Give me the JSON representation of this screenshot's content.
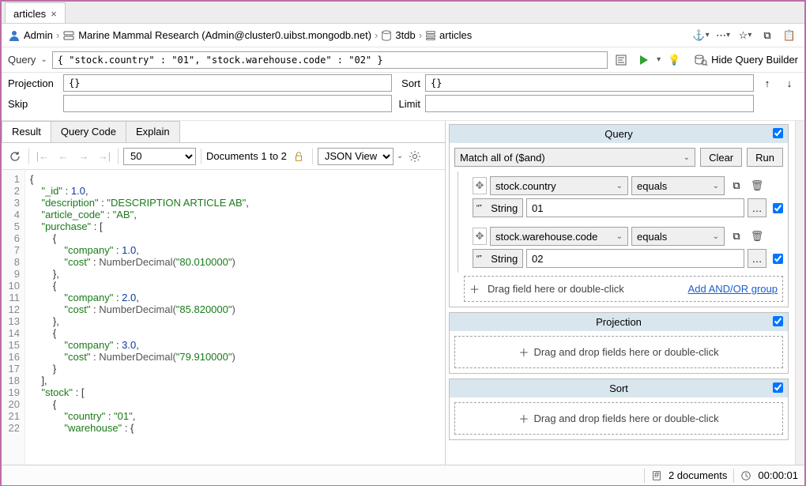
{
  "tab": {
    "title": "articles"
  },
  "breadcrumb": {
    "user": "Admin",
    "connection": "Marine Mammal Research (Admin@cluster0.uibst.mongodb.net)",
    "database": "3tdb",
    "collection": "articles"
  },
  "query": {
    "label": "Query",
    "text": "{ \"stock.country\" : \"01\", \"stock.warehouse.code\" : \"02\" }",
    "hide_builder_label": "Hide Query Builder"
  },
  "form": {
    "projection_label": "Projection",
    "projection_value": "{}",
    "sort_label": "Sort",
    "sort_value": "{}",
    "skip_label": "Skip",
    "skip_value": "",
    "limit_label": "Limit",
    "limit_value": ""
  },
  "left_tabs": {
    "result": "Result",
    "query_code": "Query Code",
    "explain": "Explain"
  },
  "left_toolbar": {
    "page_size": "50",
    "doc_range": "Documents 1 to 2",
    "view_mode": "JSON View"
  },
  "json_lines": [
    "{",
    "    \"_id\" : 1.0,",
    "    \"description\" : \"DESCRIPTION ARTICLE AB\",",
    "    \"article_code\" : \"AB\",",
    "    \"purchase\" : [",
    "        {",
    "            \"company\" : 1.0,",
    "            \"cost\" : NumberDecimal(\"80.010000\")",
    "        },",
    "        {",
    "            \"company\" : 2.0,",
    "            \"cost\" : NumberDecimal(\"85.820000\")",
    "        },",
    "        {",
    "            \"company\" : 3.0,",
    "            \"cost\" : NumberDecimal(\"79.910000\")",
    "        }",
    "    ],",
    "    \"stock\" : [",
    "        {",
    "            \"country\" : \"01\",",
    "            \"warehouse\" : {"
  ],
  "qb": {
    "query_title": "Query",
    "match_mode": "Match all of ($and)",
    "clear": "Clear",
    "run": "Run",
    "cond1_field": "stock.country",
    "cond1_op": "equals",
    "cond1_type": "String",
    "cond1_value": "01",
    "cond2_field": "stock.warehouse.code",
    "cond2_op": "equals",
    "cond2_type": "String",
    "cond2_value": "02",
    "drag_hint": "Drag field here or double-click",
    "add_group": "Add AND/OR group",
    "projection_title": "Projection",
    "proj_hint": "Drag and drop fields here or double-click",
    "sort_title": "Sort",
    "sort_hint": "Drag and drop fields here or double-click"
  },
  "status": {
    "doc_count": "2 documents",
    "elapsed": "00:00:01"
  }
}
